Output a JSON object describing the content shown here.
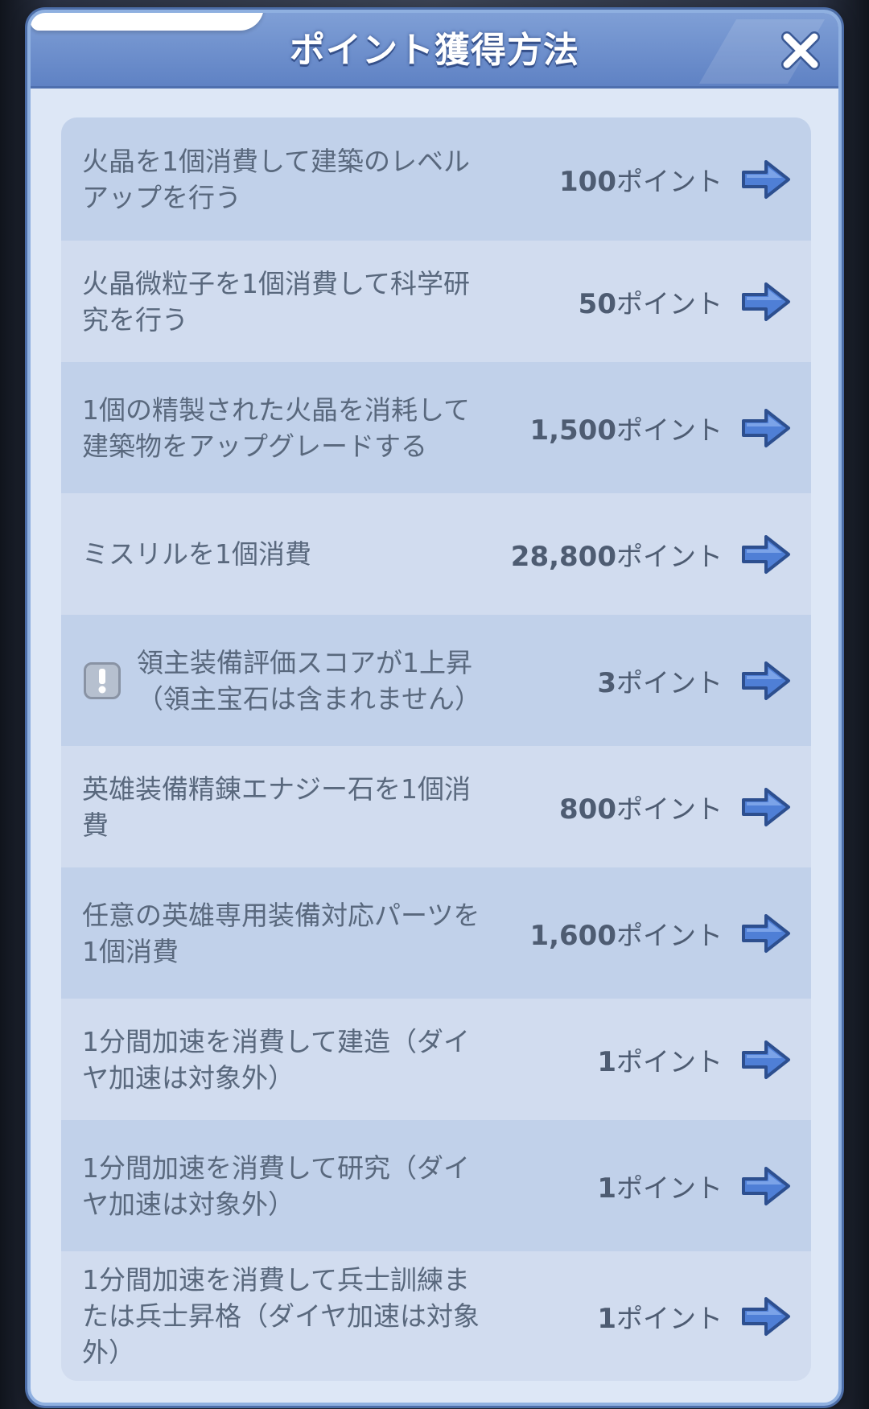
{
  "dialog": {
    "title": "ポイント獲得方法",
    "close_icon": "close-icon"
  },
  "colors": {
    "header": "#6f90cf",
    "panel": "#dde7f6",
    "row_dark": "#c1d1ea",
    "row_light": "#d1dcef",
    "arrow": "#4f7fd6"
  },
  "rows": [
    {
      "desc": "火晶を1個消費して建築のレベルアップを行う",
      "value": "100",
      "unit": "ポイント",
      "icon": "arrow-right-icon"
    },
    {
      "desc": "火晶微粒子を1個消費して科学研究を行う",
      "value": "50",
      "unit": "ポイント",
      "icon": "arrow-right-icon"
    },
    {
      "desc": "1個の精製された火晶を消耗して建築物をアップグレードする",
      "value": "1,500",
      "unit": "ポイント",
      "icon": "arrow-right-icon"
    },
    {
      "desc": "ミスリルを1個消費",
      "value": "28,800",
      "unit": "ポイント",
      "icon": "arrow-right-icon"
    },
    {
      "desc": "領主装備評価スコアが1上昇（領主宝石は含まれません）",
      "value": "3",
      "unit": "ポイント",
      "icon": "arrow-right-icon",
      "info_icon": "exclamation-icon"
    },
    {
      "desc": "英雄装備精錬エナジー石を1個消費",
      "value": "800",
      "unit": "ポイント",
      "icon": "arrow-right-icon"
    },
    {
      "desc": "任意の英雄専用装備対応パーツを1個消費",
      "value": "1,600",
      "unit": "ポイント",
      "icon": "arrow-right-icon"
    },
    {
      "desc": "1分間加速を消費して建造（ダイヤ加速は対象外）",
      "value": "1",
      "unit": "ポイント",
      "icon": "arrow-right-icon"
    },
    {
      "desc": "1分間加速を消費して研究（ダイヤ加速は対象外）",
      "value": "1",
      "unit": "ポイント",
      "icon": "arrow-right-icon"
    },
    {
      "desc": "1分間加速を消費して兵士訓練または兵士昇格（ダイヤ加速は対象外）",
      "value": "1",
      "unit": "ポイント",
      "icon": "arrow-right-icon"
    }
  ]
}
